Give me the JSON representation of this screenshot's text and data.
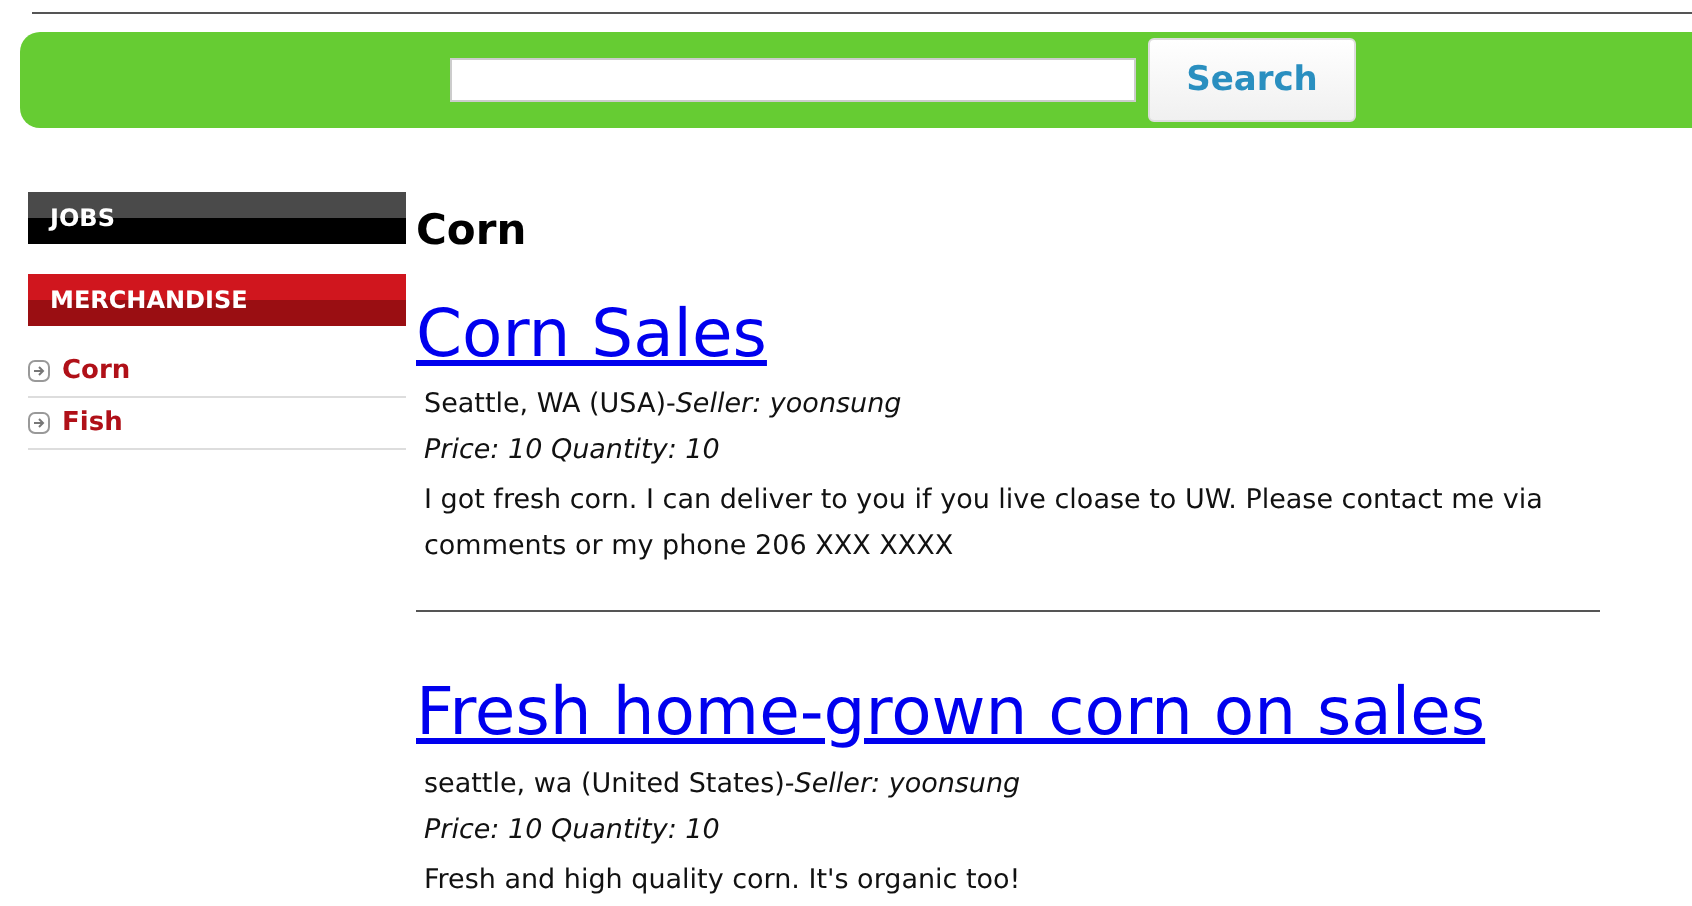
{
  "search": {
    "button": "Search"
  },
  "sidebar": {
    "sections": [
      {
        "title": "JOBS",
        "kind": "dark"
      },
      {
        "title": "MERCHANDISE",
        "kind": "red"
      }
    ],
    "items": [
      {
        "label": "Corn"
      },
      {
        "label": "Fish"
      }
    ]
  },
  "category": "Corn",
  "listings": [
    {
      "title": "Corn Sales",
      "location": "Seattle, WA (USA)-*Seller: yoonsung*",
      "price": "Price: 10 Quantity: 10",
      "description": "I got fresh corn. I can deliver to you if you live cloase to UW. Please contact me via comments or my phone 206 XXX XXXX"
    },
    {
      "title": "Fresh home-grown corn on sales",
      "location": "seattle, wa (United States)-*Seller: yoonsung*",
      "price": "Price: 10 Quantity: 10",
      "description": "Fresh and high quality corn. It's organic too!"
    }
  ]
}
